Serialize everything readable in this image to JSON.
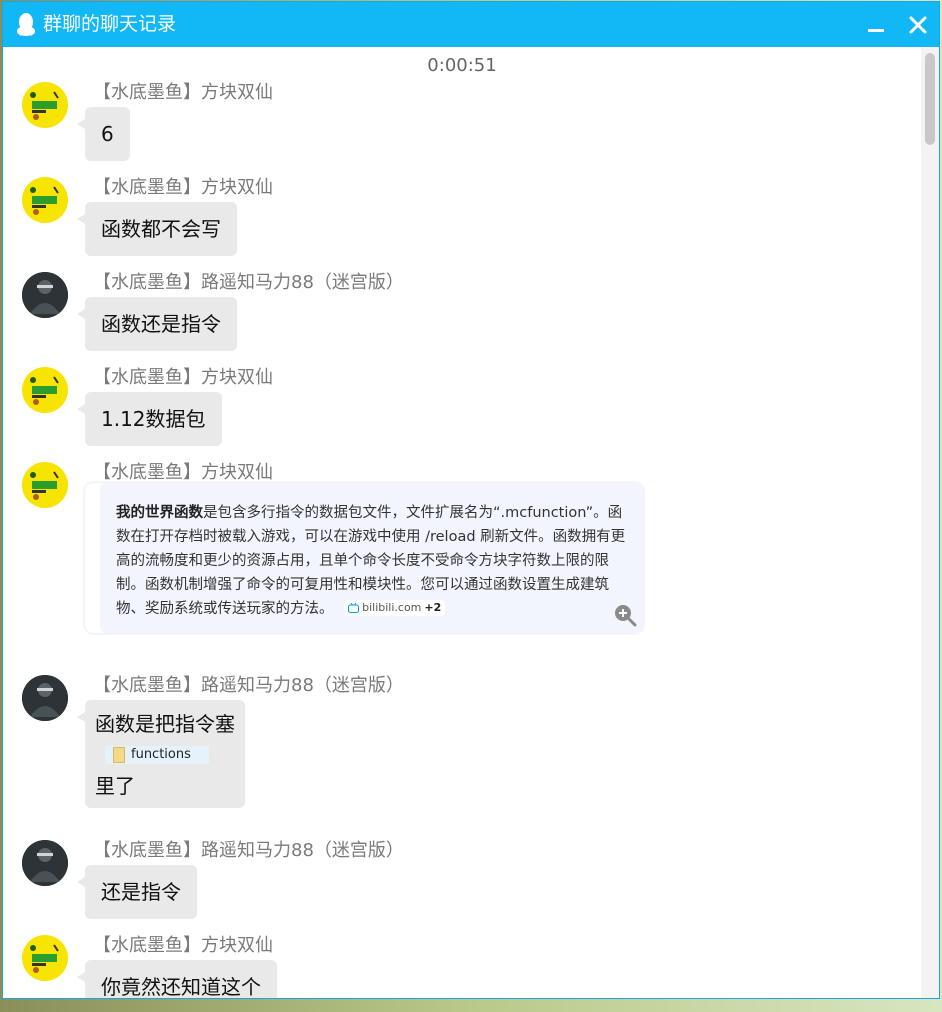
{
  "window": {
    "title": "群聊的聊天记录",
    "accent": "#12b7f5",
    "title_icon": "penguin-icon",
    "minimize_icon": "minimize-icon",
    "close_icon": "close-icon"
  },
  "timestamp": "0:00:51",
  "messages": [
    {
      "sender": "【水底墨鱼】方块双仙",
      "avatar": "yellow",
      "text": "6"
    },
    {
      "sender": "【水底墨鱼】方块双仙",
      "avatar": "yellow",
      "text": "函数都不会写"
    },
    {
      "sender": "【水底墨鱼】路遥知马力88（迷宫版）",
      "avatar": "dark",
      "text": "函数还是指令"
    },
    {
      "sender": "【水底墨鱼】方块双仙",
      "avatar": "yellow",
      "text": "1.12数据包"
    },
    {
      "sender": "【水底墨鱼】方块双仙",
      "avatar": "yellow",
      "card": {
        "bold": "我的世界函数",
        "text": "是包含多行指令的数据包文件，文件扩展名为“.mcfunction”。函数在打开存档时被载入游戏，可以在游戏中使用 /reload 刷新文件。函数拥有更高的流畅度和更少的资源占用，且单个命令长度不受命令方块字符数上限的限制。函数机制增强了命令的可复用性和模块性。您可以通过函数设置生成建筑物、奖励系统或传送玩家的方法。",
        "source": "bilibili.com",
        "more": "+2"
      }
    },
    {
      "sender": "【水底墨鱼】路遥知马力88（迷宫版）",
      "avatar": "dark",
      "text_before": "函数是把指令塞",
      "file": "functions",
      "text_after": "里了"
    },
    {
      "sender": "【水底墨鱼】路遥知马力88（迷宫版）",
      "avatar": "dark",
      "text": "还是指令"
    },
    {
      "sender": "【水底墨鱼】方块双仙",
      "avatar": "yellow",
      "text": "你竟然还知道这个"
    }
  ]
}
